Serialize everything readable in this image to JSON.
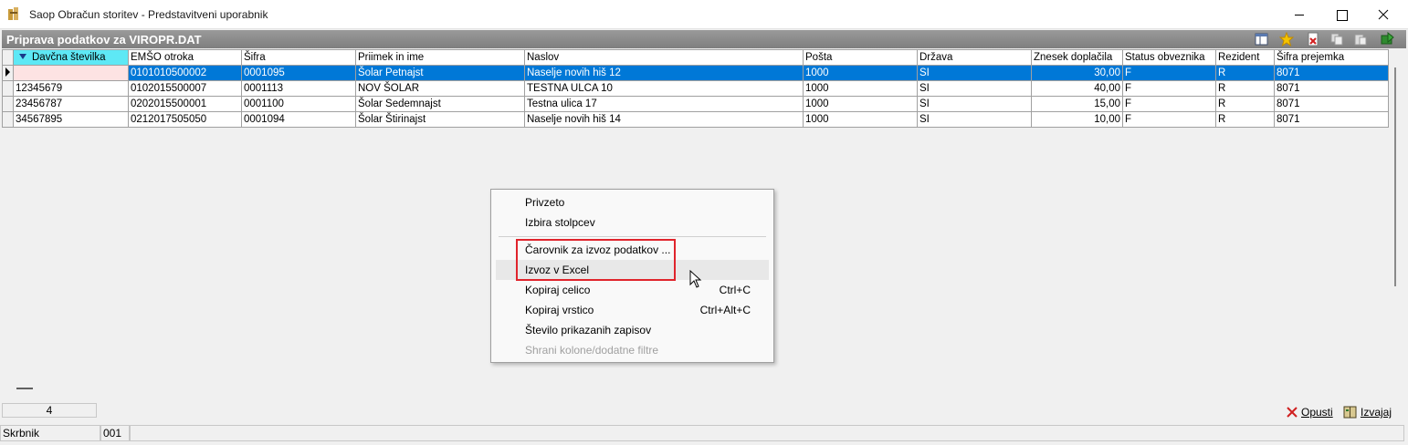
{
  "window": {
    "title": "Saop Obračun storitev - Predstavitveni uporabnik"
  },
  "header": {
    "title": "Priprava podatkov za VIROPR.DAT",
    "toolbar_icons": [
      "column-chooser-icon",
      "favorite-star-icon",
      "delete-icon",
      "copy-icon",
      "paste-icon",
      "exit-icon"
    ]
  },
  "grid": {
    "columns": [
      "Davčna številka",
      "EMŠO otroka",
      "Šifra",
      "Priimek in ime",
      "Naslov",
      "Pošta",
      "Država",
      "Znesek doplačila",
      "Status obveznika",
      "Rezident",
      "Šifra prejemka"
    ],
    "sorted_column": "Davčna številka",
    "selected_row": 0,
    "rows": [
      [
        "",
        "0101010500002",
        "0001095",
        "Šolar Petnajst",
        "Naselje novih hiš 12",
        "1000",
        "SI",
        "30,00",
        "F",
        "R",
        "8071"
      ],
      [
        "12345679",
        "0102015500007",
        "0001113",
        "NOV ŠOLAR",
        "TESTNA ULCA 10",
        "1000",
        "SI",
        "40,00",
        "F",
        "R",
        "8071"
      ],
      [
        "23456787",
        "0202015500001",
        "0001100",
        "Šolar Sedemnajst",
        "Testna ulica 17",
        "1000",
        "SI",
        "15,00",
        "F",
        "R",
        "8071"
      ],
      [
        "34567895",
        "0212017505050",
        "0001094",
        "Šolar Štirinajst",
        "Naselje novih hiš 14",
        "1000",
        "SI",
        "10,00",
        "F",
        "R",
        "8071"
      ]
    ]
  },
  "footer": {
    "record_count": "4",
    "cancel_label": "Opusti",
    "execute_label": "Izvajaj"
  },
  "status": {
    "field1": "Skrbnik",
    "field2": "001"
  },
  "context_menu": {
    "items": [
      {
        "label": "Privzeto",
        "shortcut": ""
      },
      {
        "label": "Izbira stolpcev",
        "shortcut": ""
      },
      {
        "label": "Čarovnik za izvoz podatkov ...",
        "shortcut": ""
      },
      {
        "label": "Izvoz v Excel",
        "shortcut": ""
      },
      {
        "label": "Kopiraj celico",
        "shortcut": "Ctrl+C"
      },
      {
        "label": "Kopiraj vrstico",
        "shortcut": "Ctrl+Alt+C"
      },
      {
        "label": "Število prikazanih zapisov",
        "shortcut": ""
      },
      {
        "label": "Shrani kolone/dodatne filtre",
        "shortcut": ""
      }
    ],
    "hovered": "Izvoz v Excel",
    "disabled": [
      "Shrani kolone/dodatne filtre"
    ]
  },
  "colors": {
    "selection": "#0078d7",
    "sorted_header": "#5ee8f5",
    "highlight_box": "#e0242c",
    "header_bar": "#8a8a8a"
  }
}
